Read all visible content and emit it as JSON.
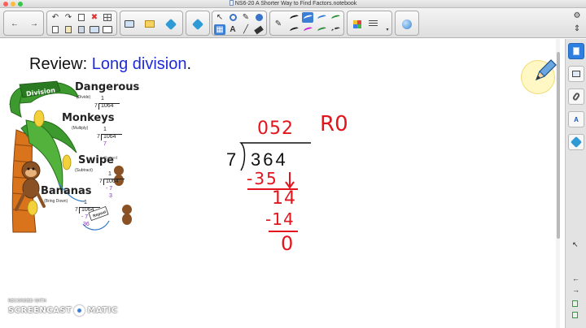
{
  "window": {
    "title": "NS6-20 A Shorter Way to Find Factors.notebook"
  },
  "toolbar": {
    "groups": [
      {
        "name": "navigation",
        "buttons": [
          "back-arrow-icon",
          "forward-arrow-icon"
        ]
      },
      {
        "name": "edit",
        "buttons": [
          "undo-icon",
          "redo-icon",
          "copy-icon",
          "delete-icon",
          "table-icon",
          "new-page-icon",
          "paste-icon",
          "save-icon",
          "screen-shade-icon",
          "fullscreen-icon"
        ]
      },
      {
        "name": "display",
        "buttons": [
          "monitor-icon",
          "response-icon",
          "add-ons-icon"
        ]
      },
      {
        "name": "tools",
        "buttons": [
          "select-icon",
          "shapes-icon",
          "pen-icon",
          "text-icon",
          "eraser-icon"
        ]
      },
      {
        "name": "pen-styles",
        "buttons": [
          "pen-style-icon"
        ]
      },
      {
        "name": "properties",
        "buttons": [
          "color-palette-icon",
          "line-style-icon",
          "magic-pen-icon"
        ]
      }
    ],
    "pen_colors": [
      "#1a1a1a",
      "#1a1a1a",
      "#2f7fd8",
      "#2a8c35",
      "#1a1a1a",
      "#c81fd0",
      "#2a8c35"
    ]
  },
  "slide": {
    "heading_prefix": "Review: ",
    "heading_highlight": "Long division",
    "heading_suffix": ".",
    "heading_highlight_color": "#1f2bd6"
  },
  "poster": {
    "banner": "Division",
    "steps": [
      {
        "word": "Dangerous",
        "sub": "(Divide)",
        "quotient": "1",
        "divisor": "7",
        "dividend": "1064",
        "extra": []
      },
      {
        "word": "Monkeys",
        "sub": "(Multiply)",
        "quotient": "1",
        "divisor": "7",
        "dividend": "1064",
        "extra": [
          "7"
        ]
      },
      {
        "word": "Swipe",
        "sub": "(Subtract)",
        "quotient": "1",
        "divisor": "7",
        "dividend": "1064",
        "extra": [
          "- 7",
          "3"
        ]
      },
      {
        "word": "Bananas",
        "sub": "(Bring Down)",
        "quotient": "1",
        "divisor": "7",
        "dividend": "1064",
        "extra": [
          "- 7",
          "36"
        ]
      }
    ],
    "caption_side": "Swiped",
    "sign_text": "Repeat"
  },
  "work": {
    "quotient": "052",
    "remainder": "R0",
    "divisor": "7",
    "dividend": "364",
    "steps": [
      "-35",
      "14",
      "-14",
      "0"
    ],
    "ink_color": "#e3141c"
  },
  "sidebar": {
    "tabs": [
      "page-sorter-icon",
      "gallery-icon",
      "attachments-icon",
      "properties-icon",
      "add-ons-icon"
    ],
    "properties_label": "A",
    "bottom": [
      "previous-arrow-icon",
      "next-arrow-icon",
      "small-page-icon",
      "small-page-icon"
    ]
  },
  "watermark": {
    "line1": "RECORDED WITH",
    "line2a": "SCREENCAST",
    "line2b": "MATIC"
  }
}
